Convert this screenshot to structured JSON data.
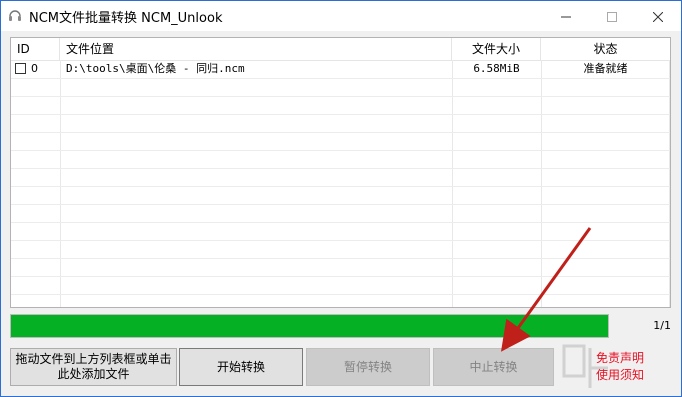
{
  "window": {
    "title": "NCM文件批量转换 NCM_Unlook"
  },
  "list": {
    "columns": [
      "ID",
      "文件位置",
      "文件大小",
      "状态"
    ],
    "rows": [
      {
        "checked": false,
        "id": "0",
        "path": "D:\\tools\\桌面\\伦桑 - 同归.ncm",
        "size": "6.58MiB",
        "status": "准备就绪"
      }
    ]
  },
  "progress": {
    "fraction": 1.0,
    "count_text": "1/1",
    "color": "#06b025"
  },
  "buttons": {
    "drop_label_line1": "拖动文件到上方列表框或单击",
    "drop_label_line2": "此处添加文件",
    "start_label": "开始转换",
    "pause_label": "暂停转换",
    "stop_label": "中止转换"
  },
  "notice": {
    "line1": "免责声明",
    "line2": "使用须知",
    "color": "#e81123"
  },
  "icons": {
    "app": "headphones-icon",
    "minimize": "minimize-icon",
    "maximize": "maximize-icon",
    "close": "close-icon"
  }
}
